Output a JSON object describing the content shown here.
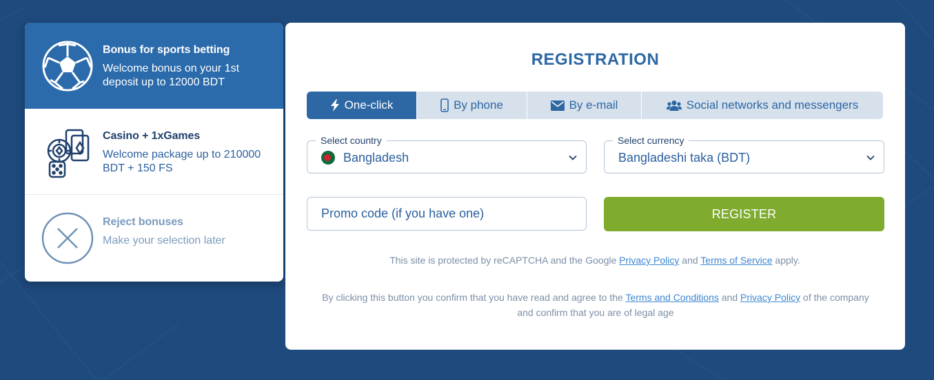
{
  "bonuses": [
    {
      "title": "Bonus for sports betting",
      "description": "Welcome bonus on your 1st deposit up to 12000 BDT",
      "icon": "soccer-ball-icon",
      "selected": true
    },
    {
      "title": "Casino + 1xGames",
      "description": "Welcome package up to 210000 BDT + 150 FS",
      "icon": "casino-chips-cards-icon",
      "selected": false
    },
    {
      "title": "Reject bonuses",
      "description": "Make your selection later",
      "icon": "close-circle-icon",
      "selected": false
    }
  ],
  "registration": {
    "title": "REGISTRATION",
    "tabs": [
      {
        "label": "One-click",
        "icon": "lightning-icon",
        "active": true
      },
      {
        "label": "By phone",
        "icon": "phone-icon",
        "active": false
      },
      {
        "label": "By e-mail",
        "icon": "envelope-icon",
        "active": false
      },
      {
        "label": "Social networks and messengers",
        "icon": "users-icon",
        "active": false
      }
    ],
    "country": {
      "label": "Select country",
      "value": "Bangladesh",
      "flag": "bangladesh-flag-icon"
    },
    "currency": {
      "label": "Select currency",
      "value": "Bangladeshi taka (BDT)"
    },
    "promo": {
      "placeholder": "Promo code (if you have one)",
      "value": ""
    },
    "register_label": "REGISTER",
    "recaptcha": {
      "before": "This site is protected by reCAPTCHA and the Google ",
      "privacy_link": "Privacy Policy",
      "and": " and ",
      "terms_link": "Terms of Service",
      "after": " apply."
    },
    "consent": {
      "before": "By clicking this button you confirm that you have read and agree to the ",
      "terms_link": "Terms and Conditions",
      "and": " and ",
      "privacy_link": "Privacy Policy",
      "after": " of the company and confirm that you are of legal age"
    }
  },
  "colors": {
    "background": "#1e4a7d",
    "accent": "#2d67a4",
    "register_button": "#7fab2f",
    "link": "#3d86d2"
  }
}
